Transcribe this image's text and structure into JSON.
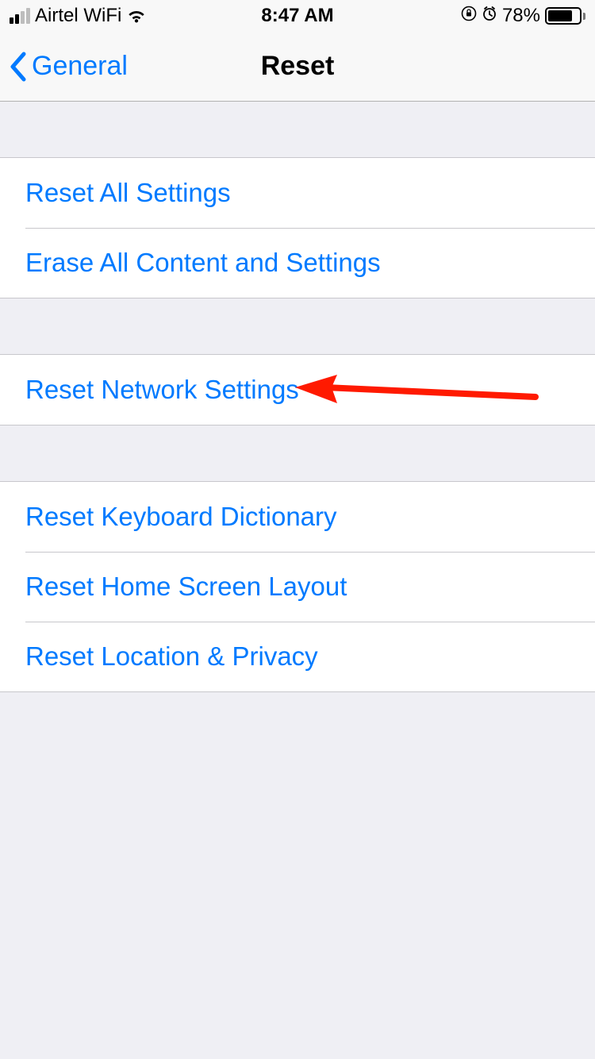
{
  "status": {
    "carrier": "Airtel WiFi",
    "time": "8:47 AM",
    "battery_pct": "78%"
  },
  "nav": {
    "back_label": "General",
    "title": "Reset"
  },
  "sections": {
    "s1": {
      "reset_all": "Reset All Settings",
      "erase_all": "Erase All Content and Settings"
    },
    "s2": {
      "reset_network": "Reset Network Settings"
    },
    "s3": {
      "reset_keyboard": "Reset Keyboard Dictionary",
      "reset_home": "Reset Home Screen Layout",
      "reset_location": "Reset Location & Privacy"
    }
  }
}
